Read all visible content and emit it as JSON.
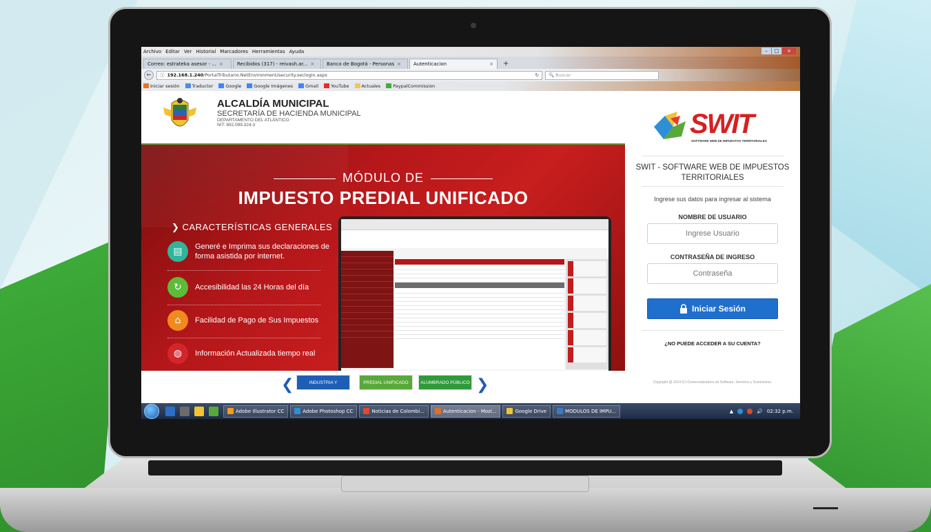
{
  "browser": {
    "menu": [
      "Archivo",
      "Editar",
      "Ver",
      "Historial",
      "Marcadores",
      "Herramientas",
      "Ayuda"
    ],
    "tabs": [
      {
        "label": "Correo: estrateka asesor - ..."
      },
      {
        "label": "Recibidos (317) - reivash.ar..."
      },
      {
        "label": "Banco de Bogotá - Personas"
      },
      {
        "label": "Autenticacion"
      }
    ],
    "url_host": "192.168.1.240",
    "url_path": "/PortalTributario.NetEnvironment/security.seclogin.aspx",
    "search_placeholder": "Buscar",
    "bookmarks": [
      "Iniciar sesión",
      "Traductor",
      "Google",
      "Google Imágenes",
      "Gmail",
      "YouTube",
      "Actuales",
      "PaypalCommission"
    ]
  },
  "header": {
    "title": "ALCALDÍA MUNICIPAL",
    "subtitle": "SECRETARÍA DE HACIENDA MUNICIPAL",
    "department": "DEPARTAMENTO DEL ATLÁNTICO",
    "nit": "NIT: 892.099.324-3"
  },
  "banner": {
    "pre_title": "MÓDULO DE",
    "title": "IMPUESTO PREDIAL UNIFICADO",
    "section": "CARACTERÍSTICAS GENERALES",
    "features": [
      {
        "text": "Generé e Imprima sus declaraciones de forma asistida por internet.",
        "icon": "document-icon",
        "color": "#2fb59a"
      },
      {
        "text": "Accesibilidad las 24 Horas del día",
        "icon": "clock-24-icon",
        "color": "#5dbb3a"
      },
      {
        "text": "Facilidad de Pago de Sus Impuestos",
        "icon": "house-icon",
        "color": "#f08a1c"
      },
      {
        "text": "Información Actualizada tiempo real",
        "icon": "globe-icon",
        "color": "#d4262a"
      }
    ]
  },
  "carousel": {
    "items": [
      {
        "label": "INDUSTRIA Y COMERCIO",
        "color": "#1e5eb5"
      },
      {
        "label": "PREDIAL UNIFICADO",
        "color": "#58a93a"
      },
      {
        "label": "ALUMBRADO PÚBLICO",
        "color": "#2f9a3a"
      }
    ]
  },
  "login": {
    "brand": "SWIT",
    "brand_tagline": "SOFTWARE WEB DE IMPUESTOS TERRITORIALES",
    "title": "SWIT - SOFTWARE WEB DE IMPUESTOS TERRITORIALES",
    "hint": "Ingrese sus datos para ingresar al sistema",
    "user_label": "NOMBRE DE USUARIO",
    "user_placeholder": "Ingrese Usuario",
    "pass_label": "CONTRASEÑA DE INGRESO",
    "pass_placeholder": "Contraseña",
    "submit": "Iniciar Sesión",
    "forgot": "¿NO PUEDE ACCEDER A SU CUENTA?",
    "copyright": "Copyright @ 2014 OJ-Comercializadora de Software, Servicios y Suministros."
  },
  "taskbar": {
    "apps": [
      {
        "label": "Adobe Illustrator CC",
        "color": "#f39c1e"
      },
      {
        "label": "Adobe Photoshop CC",
        "color": "#2d8fd6"
      },
      {
        "label": "Noticias de Colombi...",
        "color": "#e04a2a"
      },
      {
        "label": "Autenticacion - Mozi...",
        "color": "#e07020"
      },
      {
        "label": "Google Drive",
        "color": "#f2c230"
      },
      {
        "label": "MODULOS DE IMPU...",
        "color": "#3a7ac8"
      }
    ],
    "time": "02:32 p.m."
  }
}
